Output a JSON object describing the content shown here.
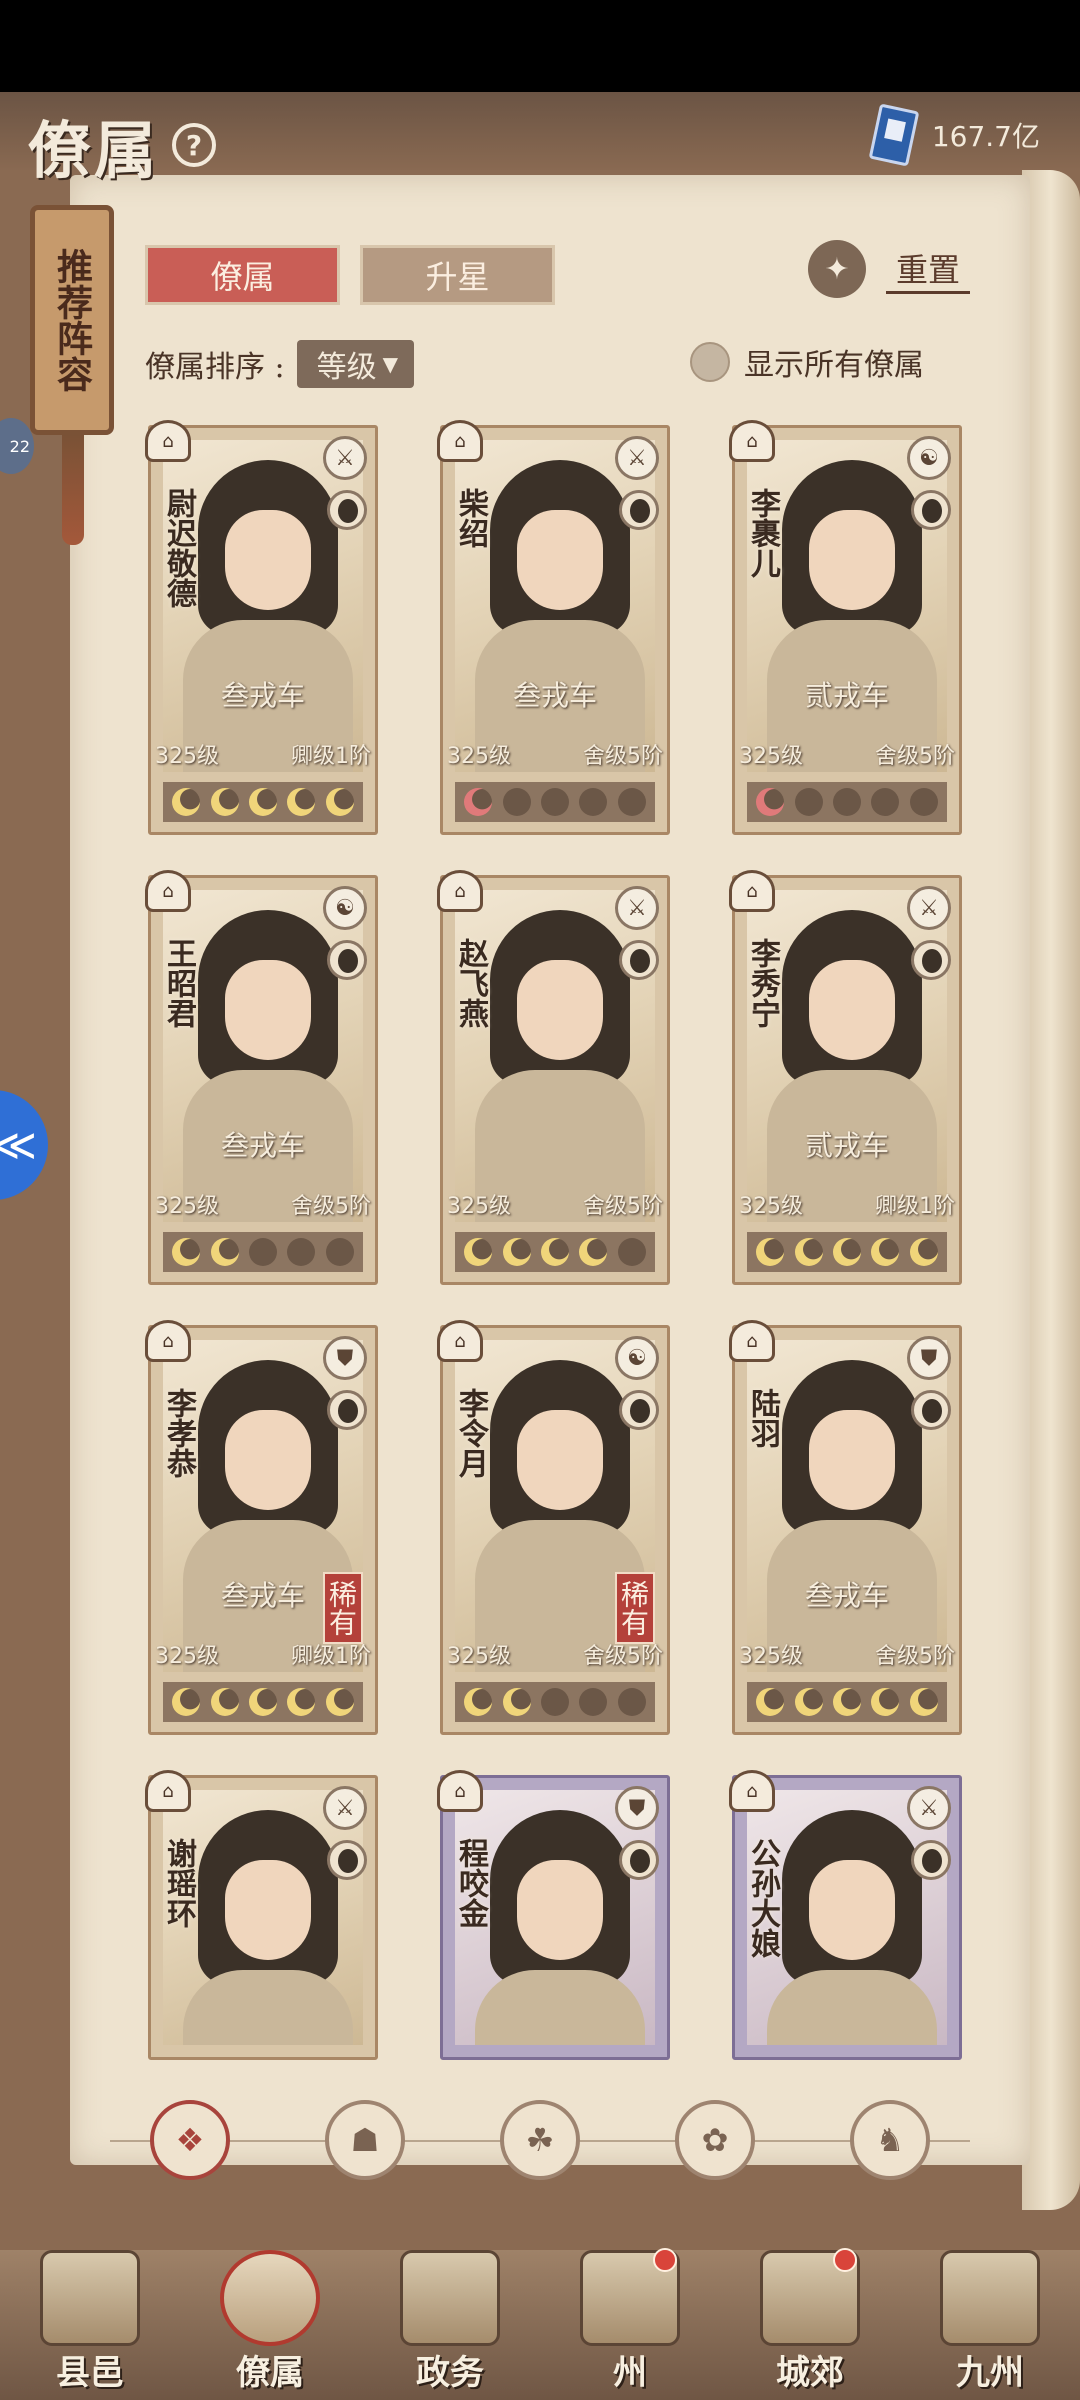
{
  "header": {
    "title": "僚属",
    "currency_value": "167.7亿"
  },
  "side": {
    "recommend_label": "推荐阵容",
    "badge_number": "22"
  },
  "tabs": [
    {
      "label": "僚属",
      "active": true
    },
    {
      "label": "升星",
      "active": false
    }
  ],
  "reset_label": "重置",
  "sort": {
    "label": "僚属排序 :",
    "value": "等级"
  },
  "show_all_label": "显示所有僚属",
  "cards": [
    {
      "name": "尉迟敬德",
      "tier": "叁戎车",
      "level": "325级",
      "rank": "卿级1阶",
      "moons": [
        "gold",
        "gold",
        "gold",
        "gold",
        "gold"
      ],
      "rare": ""
    },
    {
      "name": "柴绍",
      "tier": "叁戎车",
      "level": "325级",
      "rank": "舍级5阶",
      "moons": [
        "red",
        "dark",
        "dark",
        "dark",
        "dark"
      ],
      "rare": ""
    },
    {
      "name": "李裹儿",
      "tier": "贰戎车",
      "level": "325级",
      "rank": "舍级5阶",
      "moons": [
        "red",
        "dark",
        "dark",
        "dark",
        "dark"
      ],
      "rare": ""
    },
    {
      "name": "王昭君",
      "tier": "叁戎车",
      "level": "325级",
      "rank": "舍级5阶",
      "moons": [
        "gold",
        "gold",
        "dark",
        "dark",
        "dark"
      ],
      "rare": ""
    },
    {
      "name": "赵飞燕",
      "tier": "",
      "level": "325级",
      "rank": "舍级5阶",
      "moons": [
        "gold",
        "gold",
        "gold",
        "gold",
        "dark"
      ],
      "rare": ""
    },
    {
      "name": "李秀宁",
      "tier": "贰戎车",
      "level": "325级",
      "rank": "卿级1阶",
      "moons": [
        "gold",
        "gold",
        "gold",
        "gold",
        "gold"
      ],
      "rare": ""
    },
    {
      "name": "李孝恭",
      "tier": "叁戎车",
      "level": "325级",
      "rank": "卿级1阶",
      "moons": [
        "gold",
        "gold",
        "gold",
        "gold",
        "gold"
      ],
      "rare": "稀有"
    },
    {
      "name": "李令月",
      "tier": "",
      "level": "325级",
      "rank": "舍级5阶",
      "moons": [
        "gold",
        "gold",
        "dark",
        "dark",
        "dark"
      ],
      "rare": "稀有"
    },
    {
      "name": "陆羽",
      "tier": "叁戎车",
      "level": "325级",
      "rank": "舍级5阶",
      "moons": [
        "gold",
        "gold",
        "gold",
        "gold",
        "gold"
      ],
      "rare": ""
    },
    {
      "name": "谢瑶环",
      "tier": "",
      "level": "",
      "rank": "",
      "moons": [],
      "rare": ""
    },
    {
      "name": "程咬金",
      "tier": "",
      "level": "",
      "rank": "",
      "moons": [],
      "rare": ""
    },
    {
      "name": "公孙大娘",
      "tier": "",
      "level": "",
      "rank": "",
      "moons": [],
      "rare": ""
    }
  ],
  "filters": [
    "all",
    "faction-1",
    "faction-2",
    "faction-3",
    "faction-4"
  ],
  "nav": [
    {
      "label": "县邑",
      "active": false,
      "dot": false
    },
    {
      "label": "僚属",
      "active": true,
      "dot": false
    },
    {
      "label": "政务",
      "active": false,
      "dot": false
    },
    {
      "label": "州",
      "active": false,
      "dot": true
    },
    {
      "label": "城郊",
      "active": false,
      "dot": true
    },
    {
      "label": "九州",
      "active": false,
      "dot": false
    }
  ]
}
